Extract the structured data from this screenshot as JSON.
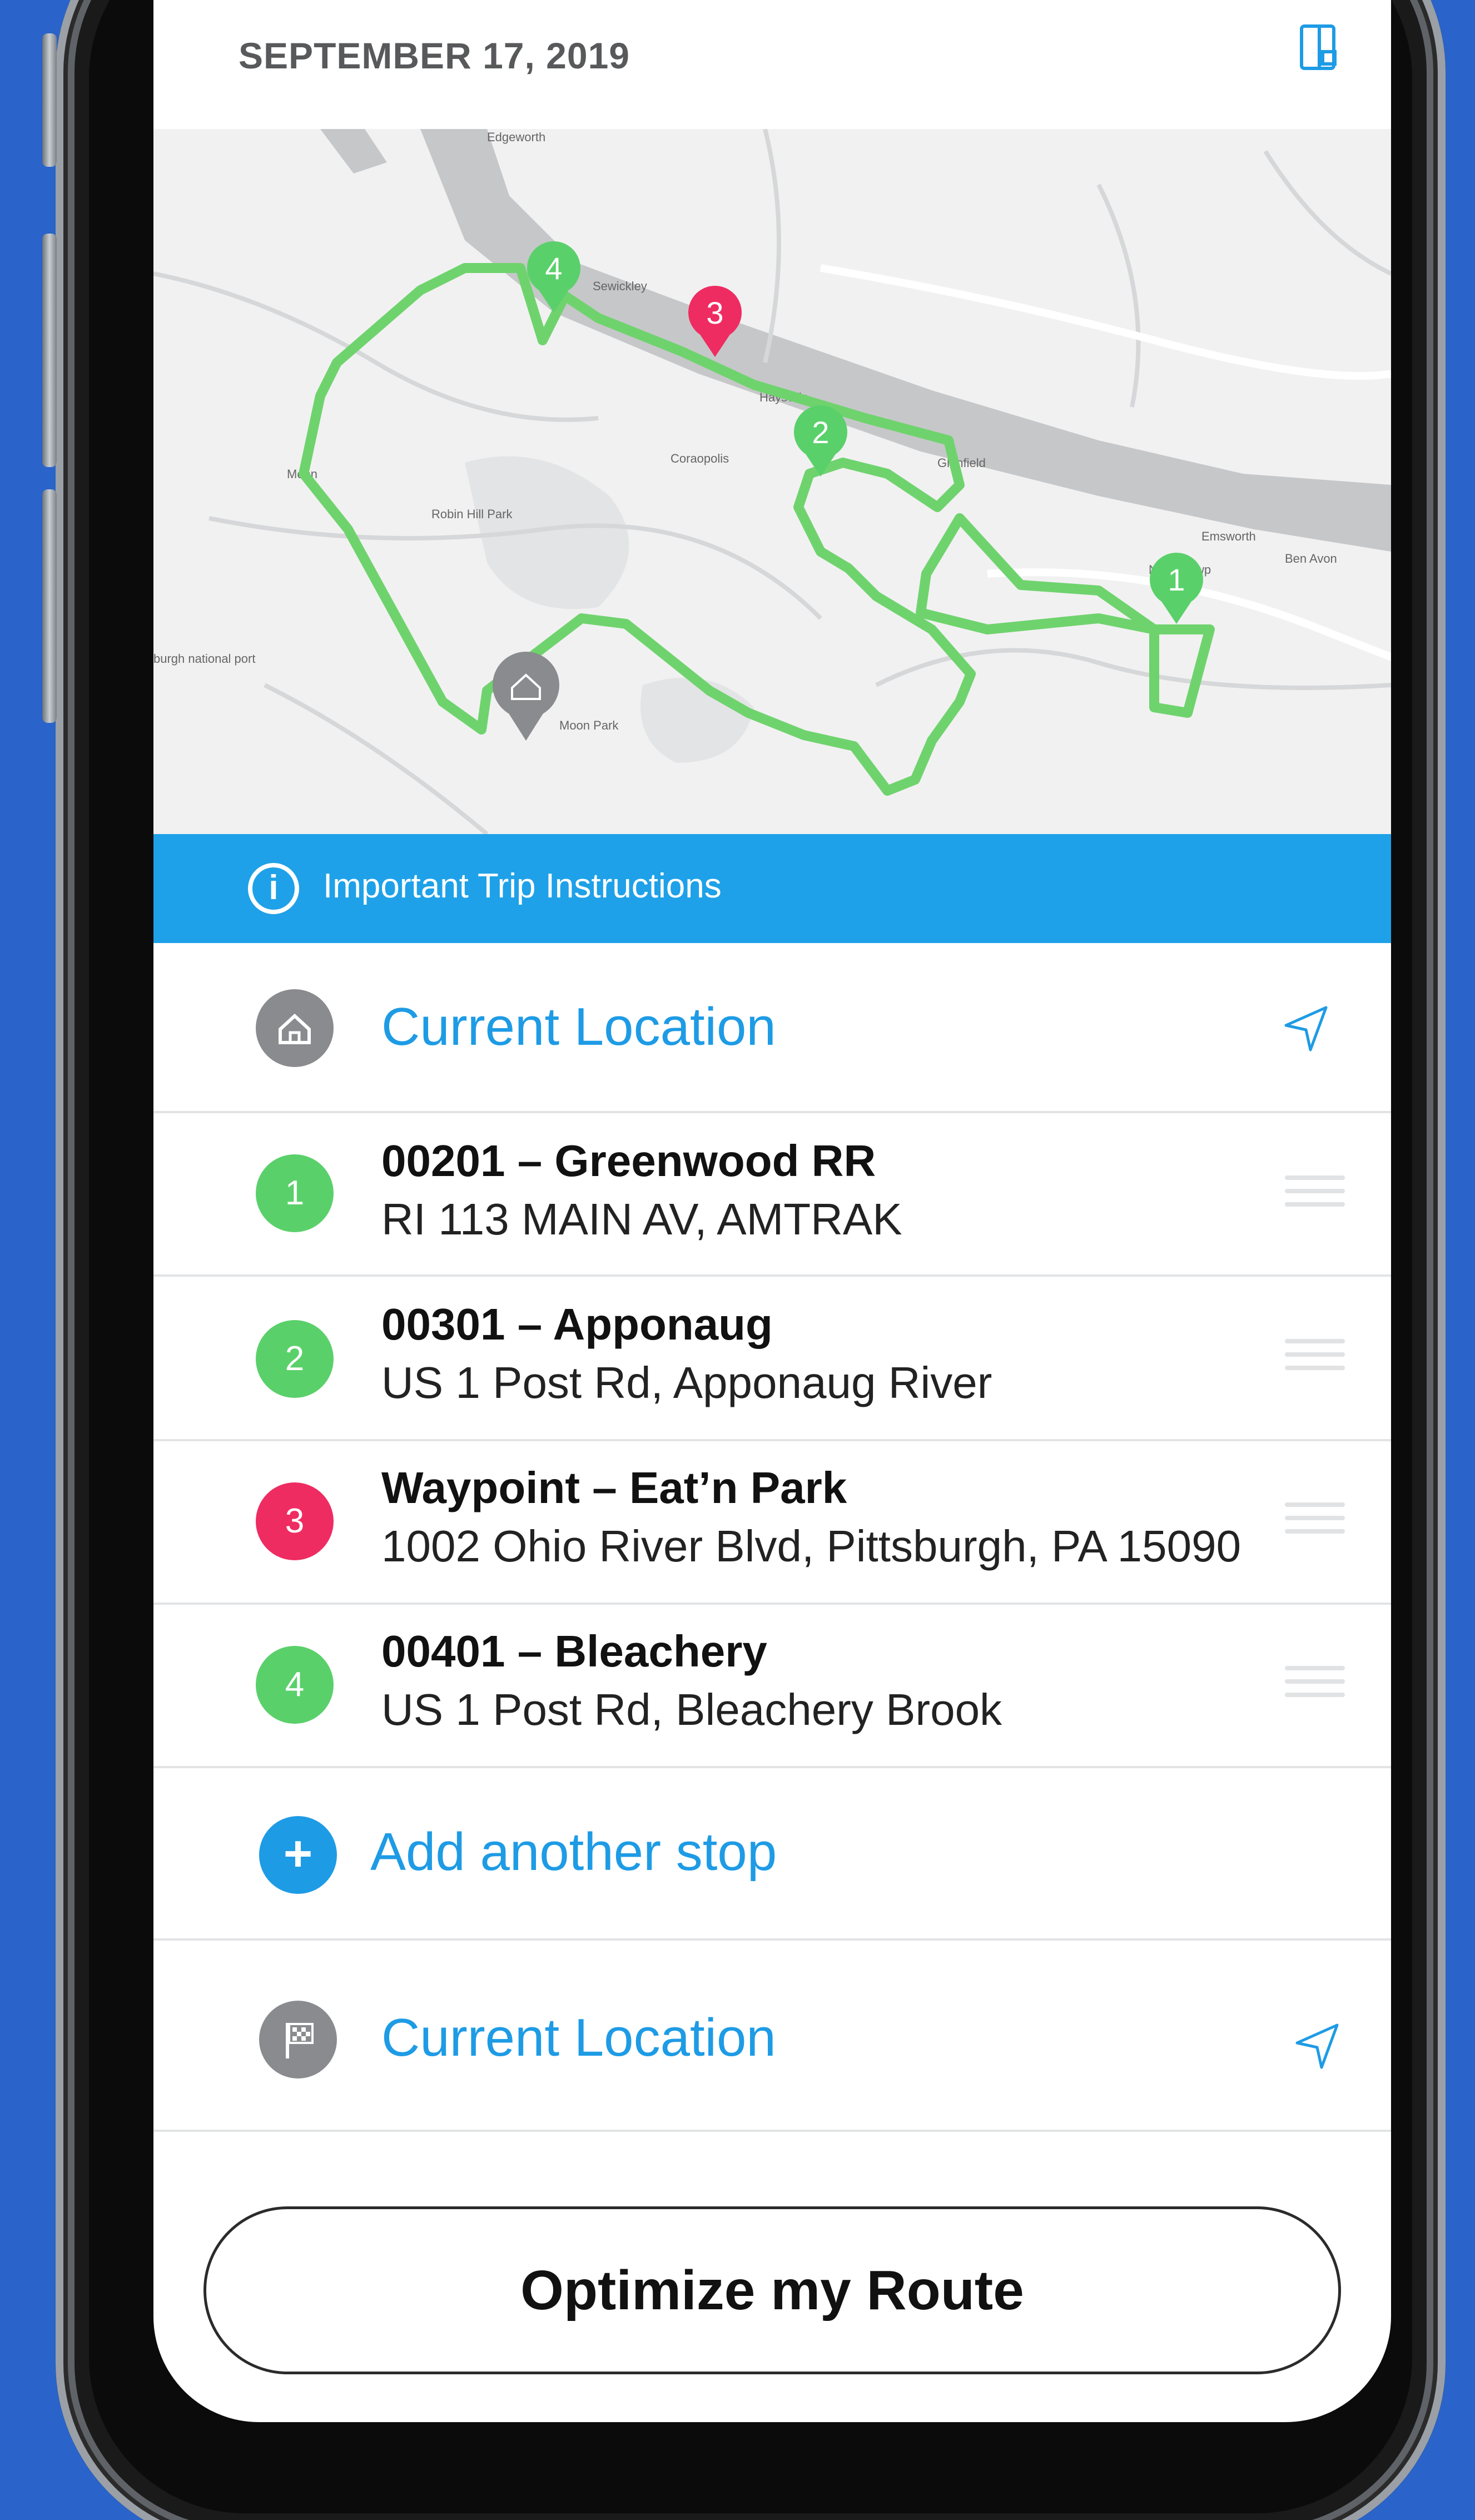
{
  "header": {
    "date": "SEPTEMBER 17, 2019",
    "icon": "book-icon"
  },
  "map": {
    "labels": [
      "Edgeworth",
      "Coraopolis",
      "Robin Hill Park",
      "Moon",
      "Haysville",
      "Emsworth",
      "Ben Avon",
      "Neville Twp",
      "Moon Park",
      "Glenfield",
      "burgh national port",
      "Sewickley"
    ],
    "markers": [
      "1",
      "2",
      "3",
      "4"
    ],
    "route_color": "#6fd36d"
  },
  "info": {
    "text": "Important Trip Instructions",
    "icon": "info-icon"
  },
  "start": {
    "label": "Current Location",
    "icon": "home-icon",
    "action_icon": "navigation-arrow-icon"
  },
  "stops": [
    {
      "number": "1",
      "title": "00201 – Greenwood RR",
      "address": "RI 113 MAIN AV, AMTRAK",
      "color": "green"
    },
    {
      "number": "2",
      "title": "00301 – Apponaug",
      "address": "US 1 Post Rd, Apponaug River",
      "color": "green"
    },
    {
      "number": "3",
      "title": "Waypoint – Eat’n Park",
      "address": "1002 Ohio River Blvd, Pittsburgh, PA 15090",
      "color": "red"
    },
    {
      "number": "4",
      "title": "00401 – Bleachery",
      "address": "US 1 Post Rd, Bleachery Brook",
      "color": "green"
    }
  ],
  "add_stop": {
    "label": "Add another stop",
    "icon": "plus-icon"
  },
  "end": {
    "label": "Current Location",
    "icon": "flag-icon",
    "action_icon": "navigation-arrow-icon"
  },
  "optimize_button": "Optimize my Route",
  "colors": {
    "accent": "#1e9be5",
    "green": "#5ad06a",
    "red": "#ee2c62",
    "background": "#2a63c9"
  }
}
